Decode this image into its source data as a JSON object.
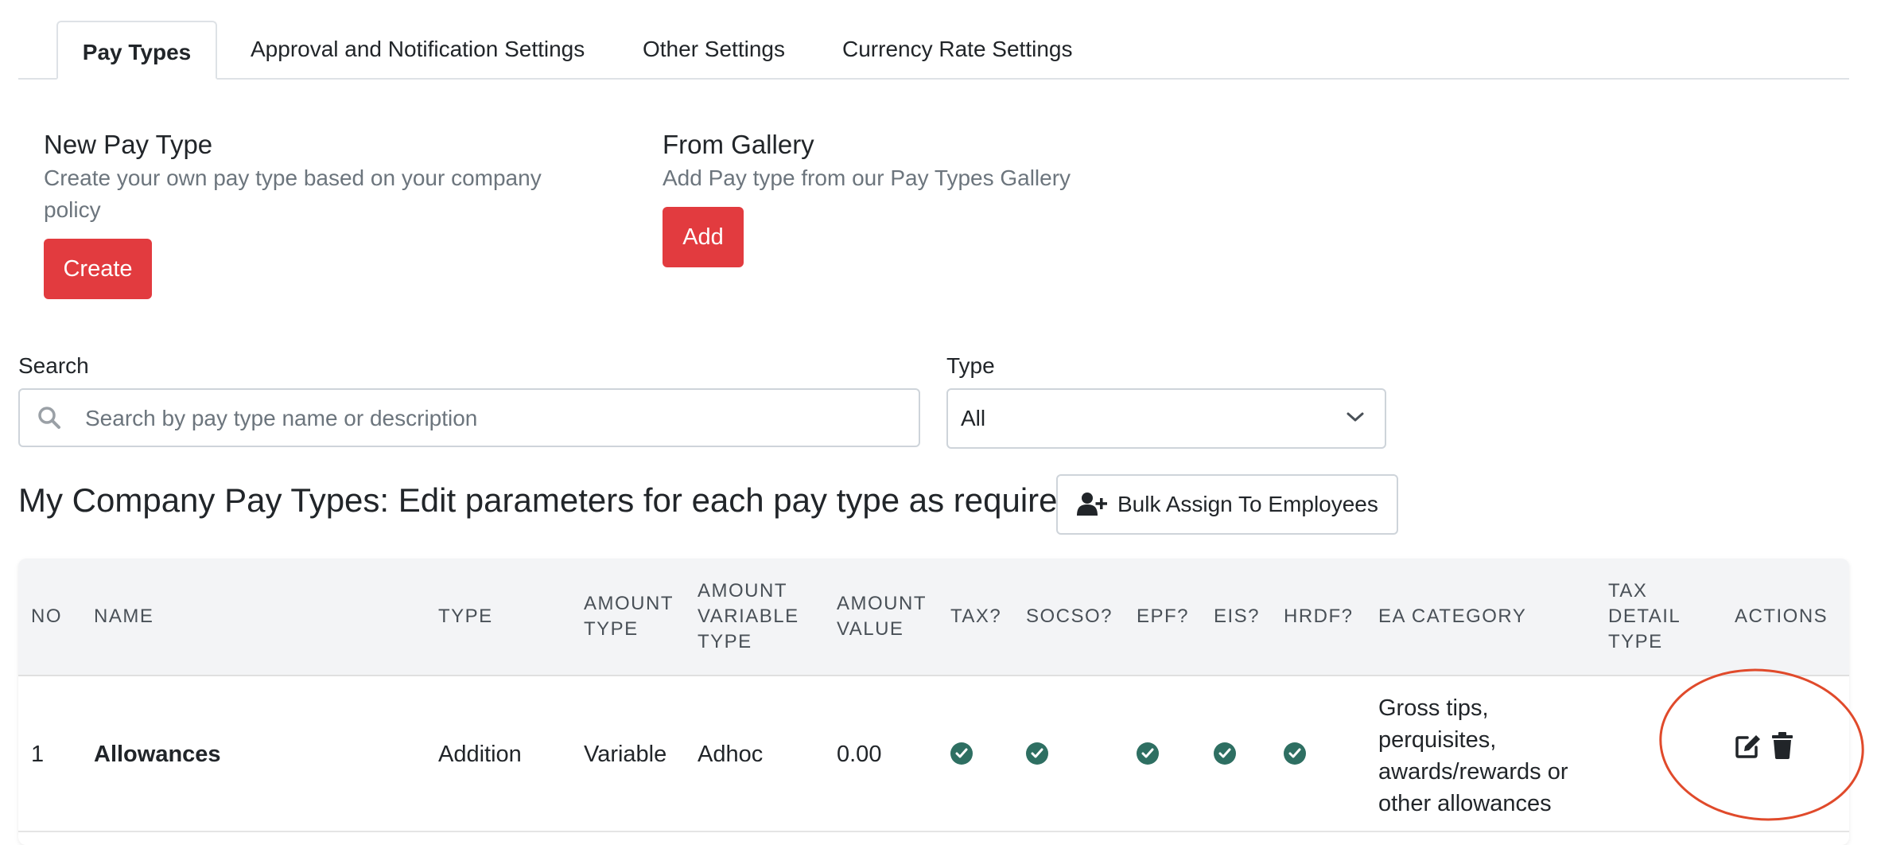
{
  "tabs": [
    {
      "label": "Pay Types",
      "active": true
    },
    {
      "label": "Approval and Notification Settings"
    },
    {
      "label": "Other Settings"
    },
    {
      "label": "Currency Rate Settings"
    }
  ],
  "new_pay_type": {
    "title": "New Pay Type",
    "desc_line1": "Create your own pay type based on your company",
    "desc_line2": "policy",
    "button": "Create"
  },
  "from_gallery": {
    "title": "From Gallery",
    "desc": "Add Pay type from our Pay Types Gallery",
    "button": "Add"
  },
  "search": {
    "label": "Search",
    "placeholder": "Search by pay type name or description",
    "icon": "search-icon"
  },
  "type_filter": {
    "label": "Type",
    "selected": "All",
    "icon": "chevron-down-icon"
  },
  "section": {
    "title": "My Company Pay Types: Edit parameters for each pay type as required.",
    "bulk_button": "Bulk Assign To Employees",
    "bulk_icon": "user-plus-icon"
  },
  "table": {
    "headers": {
      "no": "NO",
      "name": "NAME",
      "type": "TYPE",
      "amount_type": [
        "AMOUNT",
        "TYPE"
      ],
      "amount_variable_type": [
        "AMOUNT",
        "VARIABLE",
        "TYPE"
      ],
      "amount_value": [
        "AMOUNT",
        "VALUE"
      ],
      "tax": "TAX?",
      "socso": "SOCSO?",
      "epf": "EPF?",
      "eis": "EIS?",
      "hrdf": "HRDF?",
      "ea_category": "EA CATEGORY",
      "tax_detail_type": [
        "TAX",
        "DETAIL",
        "TYPE"
      ],
      "actions": "ACTIONS"
    },
    "rows": [
      {
        "no": "1",
        "name": "Allowances",
        "type": "Addition",
        "amount_type": "Variable",
        "amount_variable_type": "Adhoc",
        "amount_value": "0.00",
        "tax": true,
        "socso": true,
        "epf": true,
        "eis": true,
        "hrdf": true,
        "ea_category": [
          "Gross tips,",
          "perquisites,",
          "awards/rewards or",
          "other allowances"
        ],
        "tax_detail_type": "",
        "actions": [
          "edit-icon",
          "trash-icon"
        ]
      }
    ]
  },
  "colors": {
    "primary_red": "#e23b3f",
    "check_green": "#2e6f62",
    "annotation_red": "#e04a2b"
  }
}
